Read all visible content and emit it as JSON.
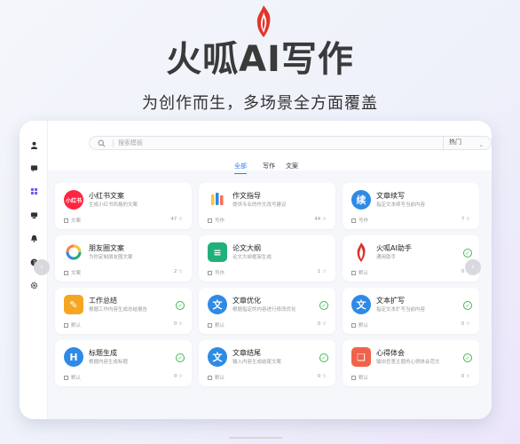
{
  "hero": {
    "title": "火呱AI写作",
    "subtitle": "为创作而生，多场景全方面覆盖"
  },
  "sidebar": {
    "icons": [
      "user-icon",
      "chat-icon",
      "apps-icon",
      "message-icon",
      "bell-icon",
      "help-icon",
      "settings-icon"
    ]
  },
  "search": {
    "placeholder": "搜索模板",
    "select_value": "热门"
  },
  "tabs": [
    {
      "label": "全部",
      "active": true
    },
    {
      "label": "写作",
      "active": false
    },
    {
      "label": "文案",
      "active": false
    }
  ],
  "cards": [
    {
      "title": "小红书文案",
      "desc": "生成小红书风格的文案",
      "category": "文案",
      "count": "47",
      "icon_text": "小红书",
      "icon_color": "#ff2442"
    },
    {
      "title": "作文指导",
      "desc": "提供专业的作文改写建议",
      "category": "写作",
      "count": "44",
      "icon_text": "",
      "icon_color": "#f6c445"
    },
    {
      "title": "文章续写",
      "desc": "指定文本续写当前内容",
      "category": "写作",
      "count": "7",
      "icon_text": "续",
      "icon_color": "#2f8ae6"
    },
    {
      "title": "朋友圈文案",
      "desc": "为你定制朋友圈文案",
      "category": "文案",
      "count": "2",
      "icon_text": "",
      "icon_color": "#ff7a45"
    },
    {
      "title": "论文大纲",
      "desc": "论文大纲框架生成",
      "category": "写作",
      "count": "1",
      "icon_text": "≡",
      "icon_color": "#21b07a"
    },
    {
      "title": "火呱AI助手",
      "desc": "通用助手",
      "category": "默认",
      "count": "0",
      "icon_text": "",
      "icon_color": "#d9342b"
    },
    {
      "title": "工作总结",
      "desc": "根据工作内容生成总结报告",
      "category": "默认",
      "count": "0",
      "icon_text": "✎",
      "icon_color": "#f5a623"
    },
    {
      "title": "文章优化",
      "desc": "根据指定的内容进行修改优化",
      "category": "默认",
      "count": "0",
      "icon_text": "文",
      "icon_color": "#2f8ae6"
    },
    {
      "title": "文本扩写",
      "desc": "指定文本扩写当前内容",
      "category": "默认",
      "count": "0",
      "icon_text": "文",
      "icon_color": "#2f8ae6"
    },
    {
      "title": "标题生成",
      "desc": "根据内容生成标题",
      "category": "默认",
      "count": "0",
      "icon_text": "H",
      "icon_color": "#2f8ae6"
    },
    {
      "title": "文章结尾",
      "desc": "输入内容生成结尾文案",
      "category": "默认",
      "count": "0",
      "icon_text": "文",
      "icon_color": "#2f8ae6"
    },
    {
      "title": "心得体会",
      "desc": "输出任意主题的心得体会范文",
      "category": "默认",
      "count": "0",
      "icon_text": "❏",
      "icon_color": "#f0634a"
    }
  ],
  "colors": {
    "accent": "#2f7fe6",
    "check": "#3fb950"
  }
}
